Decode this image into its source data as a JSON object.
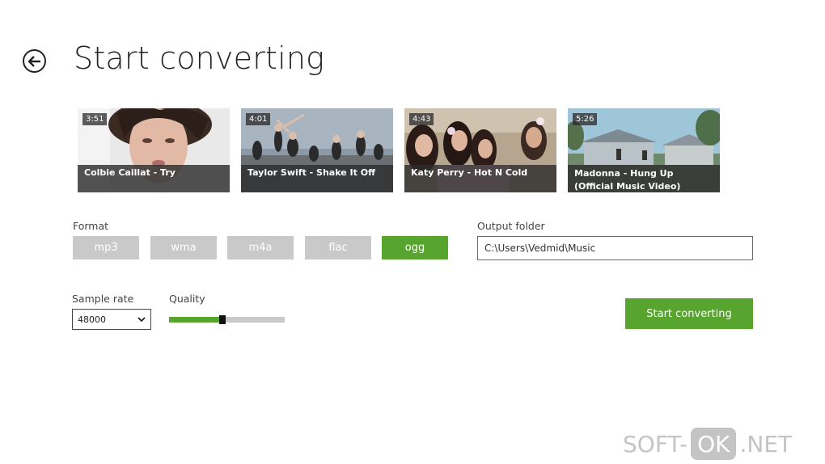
{
  "page": {
    "title": "Start converting"
  },
  "videos": [
    {
      "duration": "3:51",
      "title": "Colbie Caillat - Try"
    },
    {
      "duration": "4:01",
      "title": "Taylor Swift - Shake It Off"
    },
    {
      "duration": "4:43",
      "title": "Katy Perry - Hot N Cold"
    },
    {
      "duration": "5:26",
      "title": "Madonna - Hung Up (Official Music Video)"
    }
  ],
  "format": {
    "label": "Format",
    "options": [
      "mp3",
      "wma",
      "m4a",
      "flac",
      "ogg"
    ],
    "selected": "ogg"
  },
  "output": {
    "label": "Output folder",
    "value": "C:\\Users\\Vedmid\\Music"
  },
  "sample_rate": {
    "label": "Sample rate",
    "value": "48000"
  },
  "quality": {
    "label": "Quality",
    "level": 0.46
  },
  "actions": {
    "start_label": "Start converting"
  },
  "watermark": {
    "left": "SOFT-",
    "pill": "OK",
    "right": ".NET"
  },
  "colors": {
    "accent": "#57a42f",
    "inactive": "#c9c9c9"
  },
  "icons": {
    "back": "arrow-left-circle-icon",
    "dropdown": "chevron-down-icon"
  }
}
